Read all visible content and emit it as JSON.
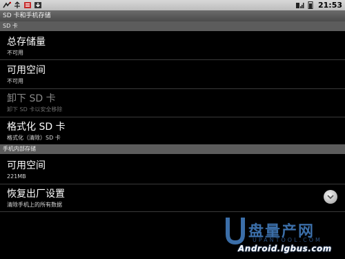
{
  "status_bar": {
    "time": "21:53",
    "left_icons": [
      "usb-debug-icon",
      "usb-connected-icon",
      "notification-icon",
      "download-icon"
    ],
    "right_icons": [
      "sim-signal-icon",
      "battery-icon"
    ]
  },
  "window_title": "SD 卡和手机存储",
  "sd_section": {
    "header": "SD 卡",
    "items": [
      {
        "title": "总存储量",
        "subtitle": "不可用"
      },
      {
        "title": "可用空间",
        "subtitle": "不可用"
      },
      {
        "title": "卸下 SD 卡",
        "subtitle": "卸下 SD 卡以安全移除"
      },
      {
        "title": "格式化 SD 卡",
        "subtitle": "格式化（清除）SD 卡"
      }
    ]
  },
  "internal_section": {
    "header": "手机内部存储",
    "items": [
      {
        "title": "可用空间",
        "subtitle": "221MB"
      },
      {
        "title": "恢复出厂设置",
        "subtitle": "清除手机上的所有数据"
      }
    ]
  },
  "watermark": {
    "brand_cn": "盘量产网",
    "url_faint": "UPANTOOL.COM",
    "url": "Android.lgbus.com"
  },
  "colors": {
    "background": "#000000",
    "section_header": "#5c5c5c",
    "watermark_blue": "#3b6ea8"
  }
}
